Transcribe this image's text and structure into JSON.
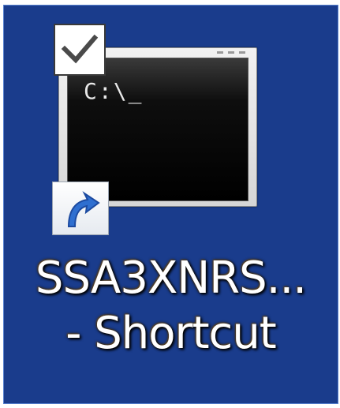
{
  "desktop_icon": {
    "label_line1": "SSA3XNRS...",
    "label_line2": "- Shortcut",
    "prompt_text": "C:\\_",
    "icon_name": "command-prompt-icon",
    "selected": true,
    "checked": true,
    "is_shortcut": true
  },
  "colors": {
    "selection_background": "#1a3c8c",
    "label_text": "#ffffff",
    "console_background": "#000000"
  }
}
